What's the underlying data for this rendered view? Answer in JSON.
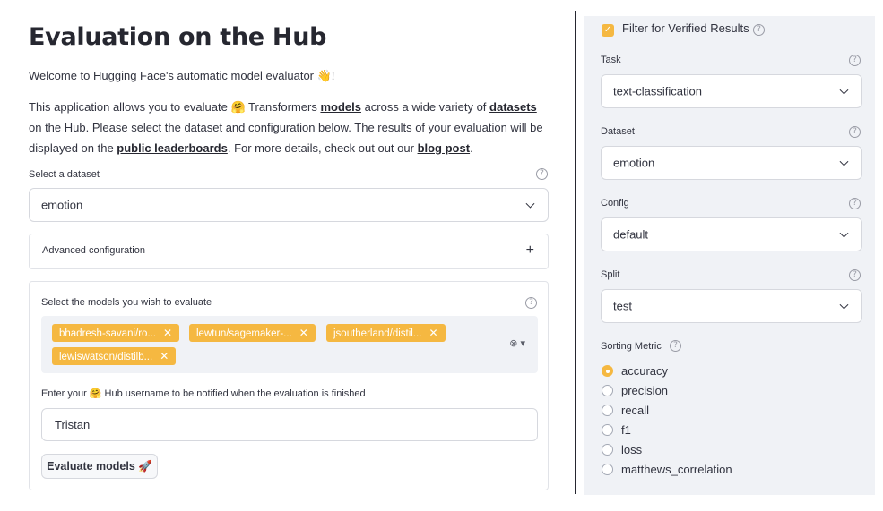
{
  "main": {
    "title": "Evaluation on the Hub",
    "welcome": "Welcome to Hugging Face's automatic model evaluator 👋!",
    "intro": {
      "p1": "This application allows you to evaluate 🤗 Transformers ",
      "models_link": "models",
      "p2": " across a wide variety of ",
      "datasets_link": "datasets",
      "p3": " on the Hub. Please select the dataset and configuration below. The results of your evaluation will be displayed on the ",
      "leaderboards_link": "public leaderboards",
      "p4": ". For more details, check out out our ",
      "blog_link": "blog post",
      "p5": "."
    },
    "dataset_label": "Select a dataset",
    "dataset_value": "emotion",
    "advanced_label": "Advanced configuration",
    "advanced_icon": "+",
    "models_label": "Select the models you wish to evaluate",
    "models": [
      "bhadresh-savani/ro...",
      "lewtun/sagemaker-...",
      "jsoutherland/distil...",
      "lewiswatson/distilb..."
    ],
    "username_label": "Enter your 🤗 Hub username to be notified when the evaluation is finished",
    "username_value": "Tristan",
    "evaluate_button": "Evaluate models 🚀"
  },
  "sidebar": {
    "verified_label": "Filter for Verified Results",
    "verified_checked": true,
    "task_label": "Task",
    "task_value": "text-classification",
    "dataset_label": "Dataset",
    "dataset_value": "emotion",
    "config_label": "Config",
    "config_value": "default",
    "split_label": "Split",
    "split_value": "test",
    "metric_label": "Sorting Metric",
    "metrics": [
      "accuracy",
      "precision",
      "recall",
      "f1",
      "loss",
      "matthews_correlation"
    ],
    "selected_metric": "accuracy"
  },
  "colors": {
    "accent": "#f5b841",
    "text": "#31333f",
    "sidebar_bg": "#f0f2f6",
    "divider": "#262730"
  },
  "icons": {
    "help": "help-circle-icon",
    "chevron": "chevron-down-icon",
    "clear": "clear-circle-icon",
    "remove": "close-icon"
  }
}
